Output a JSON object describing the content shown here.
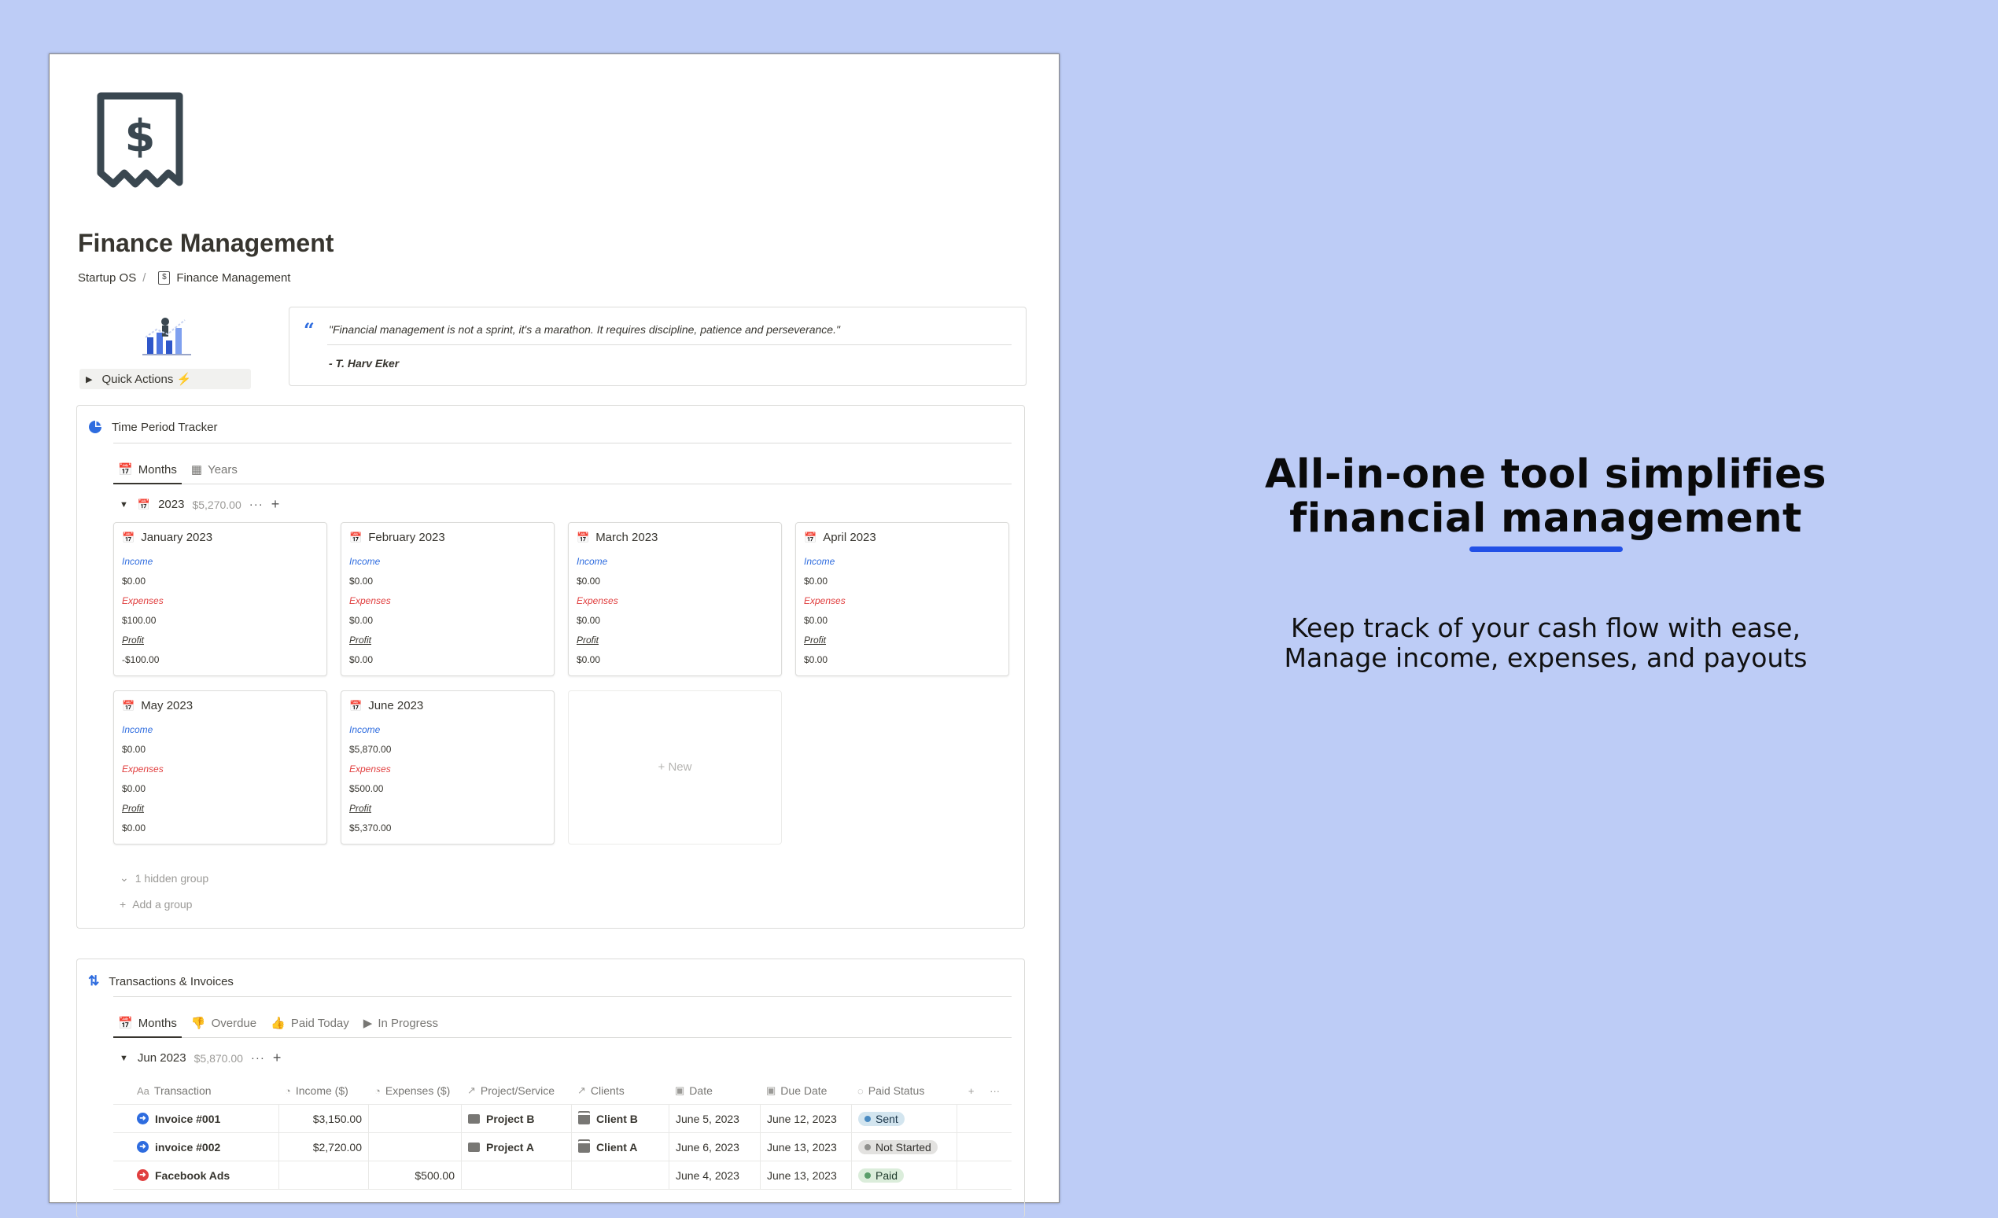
{
  "promo": {
    "title_line1": "All-in-one tool simplifies",
    "title_line2": "financial management",
    "sub_line1": "Keep track of your cash flow with ease,",
    "sub_line2": "Manage income, expenses, and payouts"
  },
  "page": {
    "icon": "receipt-dollar-icon",
    "title": "Finance Management",
    "breadcrumb": {
      "parent": "Startup OS",
      "separator": "/",
      "current": "Finance Management"
    }
  },
  "quick_actions": {
    "label": "Quick Actions ⚡"
  },
  "quote": {
    "mark": "“",
    "text": "\"Financial management is not a sprint, it's a marathon. It requires discipline, patience and perseverance.\"",
    "author": "- T. Harv Eker"
  },
  "tracker": {
    "title": "Time Period Tracker",
    "icon": "pie-chart-icon",
    "tabs": [
      {
        "label": "Months",
        "icon": "calendar-icon"
      },
      {
        "label": "Years",
        "icon": "grid-icon"
      }
    ],
    "group": {
      "label": "2023",
      "sum": "$5,270.00"
    },
    "labels": {
      "income": "Income",
      "expenses": "Expenses",
      "profit": "Profit"
    },
    "cards": [
      {
        "title": "January 2023",
        "income": "$0.00",
        "expenses": "$100.00",
        "profit": "-$100.00"
      },
      {
        "title": "February 2023",
        "income": "$0.00",
        "expenses": "$0.00",
        "profit": "$0.00"
      },
      {
        "title": "March 2023",
        "income": "$0.00",
        "expenses": "$0.00",
        "profit": "$0.00"
      },
      {
        "title": "April 2023",
        "income": "$0.00",
        "expenses": "$0.00",
        "profit": "$0.00"
      },
      {
        "title": "May 2023",
        "income": "$0.00",
        "expenses": "$0.00",
        "profit": "$0.00"
      },
      {
        "title": "June 2023",
        "income": "$5,870.00",
        "expenses": "$500.00",
        "profit": "$5,370.00"
      }
    ],
    "new_label": "+ New",
    "hidden_group": "1 hidden group",
    "add_group": "Add a group"
  },
  "transactions": {
    "title": "Transactions & Invoices",
    "icon": "arrows-up-down-icon",
    "tabs": [
      {
        "label": "Months",
        "icon": "calendar-icon"
      },
      {
        "label": "Overdue",
        "icon": "thumbs-down-icon"
      },
      {
        "label": "Paid Today",
        "icon": "thumbs-up-icon"
      },
      {
        "label": "In Progress",
        "icon": "play-icon"
      }
    ],
    "group": {
      "label": "Jun 2023",
      "sum": "$5,870.00"
    },
    "columns": [
      "Transaction",
      "Income ($)",
      "Expenses ($)",
      "Project/Service",
      "Clients",
      "Date",
      "Due Date",
      "Paid Status"
    ],
    "rows": [
      {
        "name": "Invoice #001",
        "type": "income",
        "income": "$3,150.00",
        "expenses": "",
        "project": "Project B",
        "client": "Client B",
        "date": "June 5, 2023",
        "due": "June 12, 2023",
        "status": "Sent"
      },
      {
        "name": "invoice #002",
        "type": "income",
        "income": "$2,720.00",
        "expenses": "",
        "project": "Project A",
        "client": "Client A",
        "date": "June 6, 2023",
        "due": "June 13, 2023",
        "status": "Not Started"
      },
      {
        "name": "Facebook Ads",
        "type": "expense",
        "income": "",
        "expenses": "$500.00",
        "project": "",
        "client": "",
        "date": "June 4, 2023",
        "due": "June 13, 2023",
        "status": "Paid"
      }
    ],
    "status_colors": {
      "sent": {
        "bg": "#d3e5ef",
        "dot": "#4a8bc2",
        "fg": "#183347"
      },
      "not_started": {
        "bg": "#e3e2e0",
        "dot": "#91918e",
        "fg": "#32302c"
      },
      "paid": {
        "bg": "#dbeddb",
        "dot": "#5a9e6a",
        "fg": "#1c3829"
      }
    }
  },
  "colors": {
    "background": "#bdccf6",
    "accent": "#2250e6",
    "income": "#2e6cdf",
    "expense": "#e03e3e"
  }
}
